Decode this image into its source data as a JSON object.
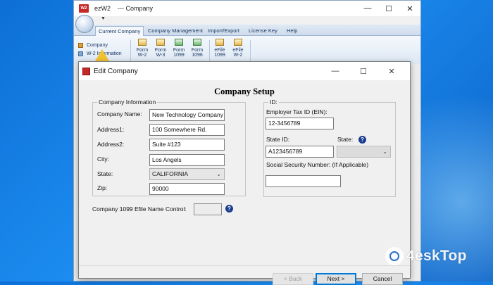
{
  "app": {
    "logo_text": "ezW2",
    "title": "ezW2",
    "subtitle": "--- Company",
    "controls": {
      "minimize": "—",
      "maximize": "☐",
      "close": "✕"
    },
    "quick_access_arrow": "▼"
  },
  "ribbon": {
    "tabs": [
      {
        "label": "Current Company",
        "active": true
      },
      {
        "label": "Company Management"
      },
      {
        "label": "Import/Export"
      },
      {
        "label": "License Key"
      },
      {
        "label": "Help"
      }
    ],
    "side_items": [
      {
        "label": "Company"
      },
      {
        "label": "W-2 Information"
      }
    ],
    "buttons": [
      {
        "label": "Form\nW-2"
      },
      {
        "label": "Form\nW-3"
      },
      {
        "label": "Form\n1099"
      },
      {
        "label": "Form\n1096"
      },
      {
        "label": "eFile\n1099"
      },
      {
        "label": "eFile\nW-2"
      }
    ]
  },
  "dialog": {
    "title": "Edit Company",
    "controls": {
      "minimize": "—",
      "maximize": "☐",
      "close": "✕"
    },
    "heading": "Company Setup",
    "company_info": {
      "legend": "Company Information",
      "fields": {
        "company_name": {
          "label": "Company Name:",
          "value": "New Technology Company"
        },
        "address1": {
          "label": "Address1:",
          "value": "100 Somewhere Rd."
        },
        "address2": {
          "label": "Address2:",
          "value": "Suite #123"
        },
        "city": {
          "label": "City:",
          "value": "Los Angels"
        },
        "state": {
          "label": "State:",
          "value": "CALIFORNIA"
        },
        "zip": {
          "label": "Zip:",
          "value": "90000"
        }
      }
    },
    "id_group": {
      "legend": "ID:",
      "ein": {
        "label": "Employer Tax ID (EIN):",
        "value": "12-3456789"
      },
      "state_id": {
        "label": "State ID:",
        "value": "A123456789"
      },
      "state": {
        "label": "State:",
        "value": ""
      },
      "ssn": {
        "label": "Social Security Number: (If Applicable)",
        "value": ""
      }
    },
    "efile_control": {
      "label": "Company 1099 Efile Name Control:",
      "value": ""
    },
    "help_glyph": "?",
    "dropdown_glyph": "⌄",
    "buttons": {
      "back": "< Back",
      "next": "Next >",
      "cancel": "Cancel"
    }
  },
  "watermark": {
    "text": "4eskTop"
  }
}
